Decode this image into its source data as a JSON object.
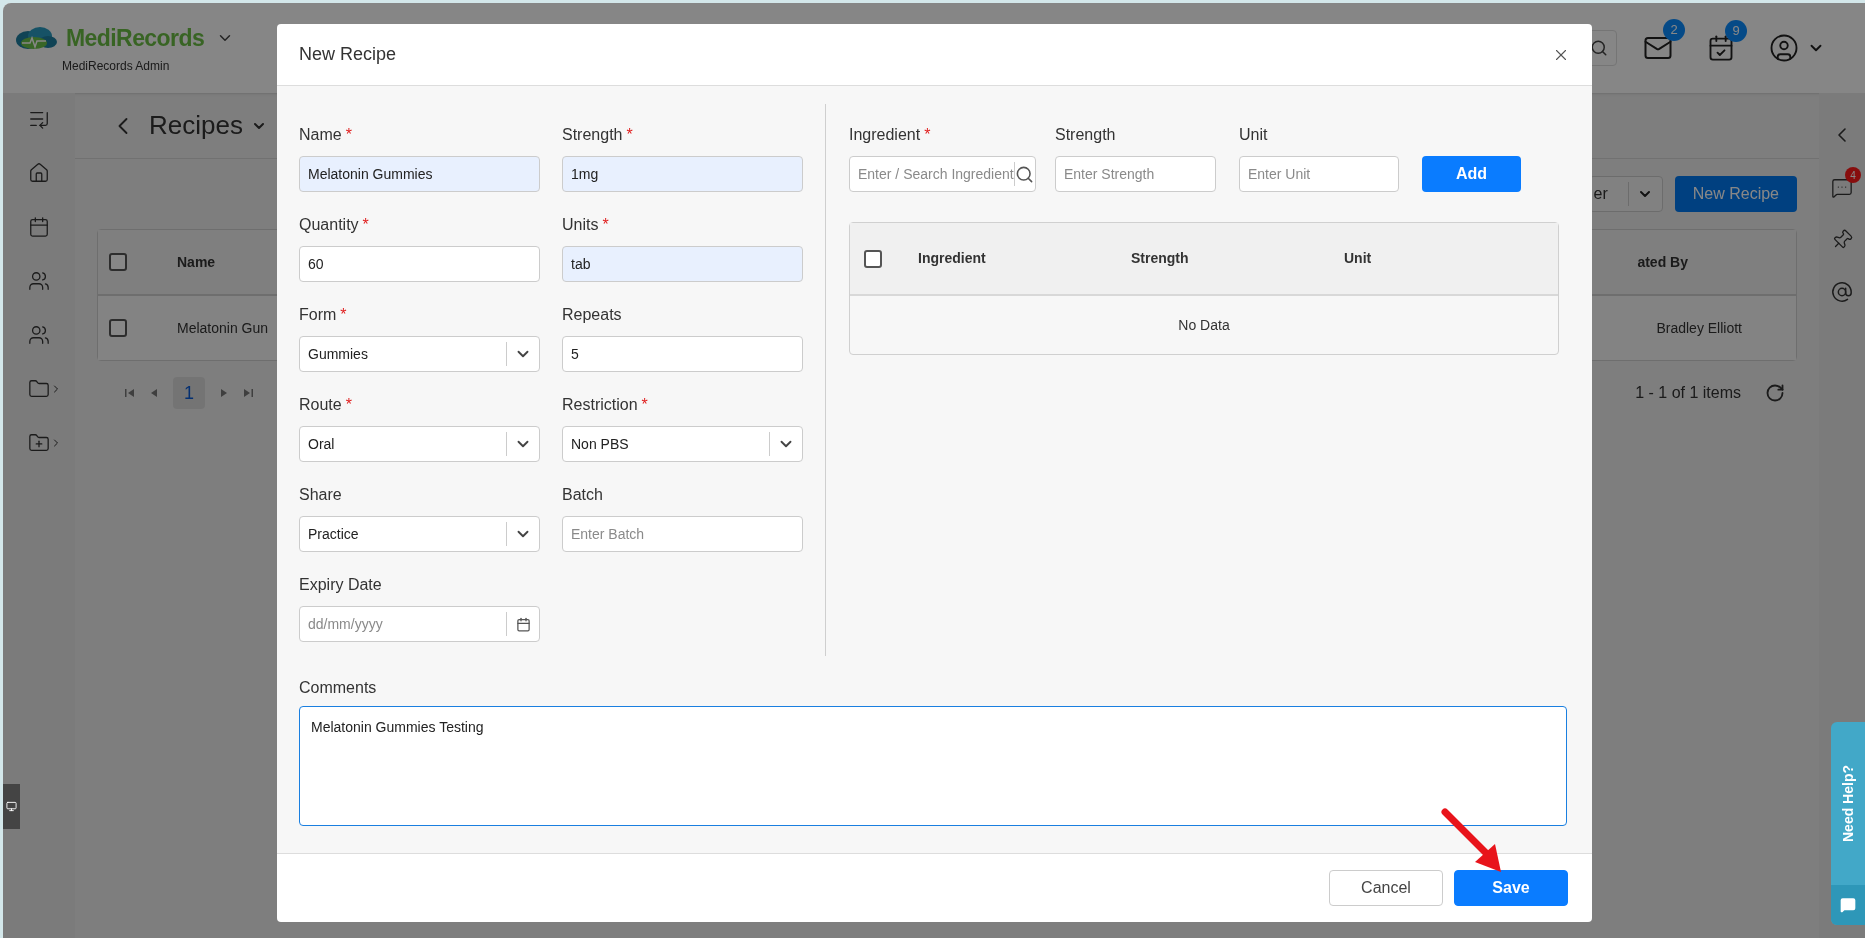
{
  "app": {
    "brand": "MediRecords",
    "account": "MediRecords Admin",
    "mail_badge": "2",
    "tasks_badge": "9"
  },
  "page": {
    "title": "Recipes",
    "filter_button": "er",
    "new_button": "New Recipe",
    "table": {
      "header_checked": false,
      "columns": [
        "Name",
        "ated By"
      ],
      "rows": [
        {
          "checked": false,
          "cells": [
            "Melatonin Gun",
            "Bradley Elliott"
          ]
        }
      ]
    },
    "pagination": {
      "pages": [
        {
          "label": "1",
          "selected": true
        }
      ],
      "summary": "1 - 1 of 1 items"
    }
  },
  "right_rail": {
    "chat_badge": "4"
  },
  "help_tab": {
    "label": "Need Help?"
  },
  "modal": {
    "title": "New Recipe",
    "fields": [
      {
        "label": "Name",
        "required_mark": "*",
        "kind": "text",
        "value": "Melatonin Gummies",
        "autofilled": true
      },
      {
        "label": "Strength",
        "required_mark": "*",
        "kind": "text",
        "value": "1mg",
        "autofilled": true
      },
      {
        "label": "Quantity",
        "required_mark": "*",
        "kind": "text",
        "value": "60",
        "autofilled": false
      },
      {
        "label": "Units",
        "required_mark": "*",
        "kind": "text",
        "value": "tab",
        "autofilled": true
      },
      {
        "label": "Form",
        "required_mark": "*",
        "kind": "select",
        "value": "Gummies",
        "autofilled": false
      },
      {
        "label": "Repeats",
        "kind": "text",
        "value": "5",
        "autofilled": false
      },
      {
        "label": "Route",
        "required_mark": "*",
        "kind": "select",
        "value": "Oral",
        "autofilled": false
      },
      {
        "label": "Restriction",
        "required_mark": "*",
        "kind": "select",
        "value": "Non PBS",
        "autofilled": false
      },
      {
        "label": "Share",
        "kind": "select",
        "value": "Practice",
        "autofilled": false
      },
      {
        "label": "Batch",
        "kind": "text",
        "placeholder": "Enter Batch",
        "autofilled": false
      },
      {
        "label": "Expiry Date",
        "kind": "date",
        "placeholder": "dd/mm/yyyy",
        "autofilled": false
      }
    ],
    "ingredient_form": {
      "fields": [
        {
          "label": "Ingredient",
          "required_mark": "*",
          "kind": "search",
          "placeholder": "Enter / Search Ingredient"
        },
        {
          "label": "Strength",
          "kind": "text",
          "placeholder": "Enter Strength"
        },
        {
          "label": "Unit",
          "kind": "text",
          "placeholder": "Enter Unit"
        }
      ],
      "add_button": "Add"
    },
    "ingredients_table": {
      "header_checked": false,
      "columns": [
        "Ingredient",
        "Strength",
        "Unit"
      ],
      "empty_text": "No Data"
    },
    "comments": {
      "label": "Comments",
      "value": "Melatonin Gummies Testing"
    },
    "buttons": [
      {
        "label": "Cancel",
        "kind": "secondary"
      },
      {
        "label": "Save",
        "kind": "primary"
      }
    ]
  }
}
